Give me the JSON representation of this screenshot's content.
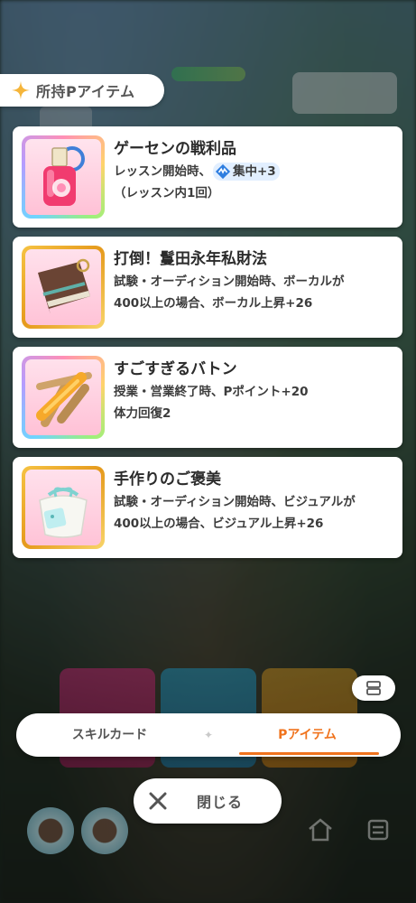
{
  "header": {
    "title": "所持Pアイテム"
  },
  "items": [
    {
      "name": "ゲーセンの戦利品",
      "desc_prefix": "レッスン開始時、",
      "chip_label": "集中+3",
      "desc_line2": "（レッスン内1回）"
    },
    {
      "name": "打倒！鬘田永年私財法",
      "desc_line1": "試験・オーディション開始時、ボーカルが",
      "desc_line2": "400以上の場合、ボーカル上昇+26"
    },
    {
      "name": "すごすぎるバトン",
      "desc_line1": "授業・営業終了時、Pポイント+20",
      "desc_line2": "体力回復2"
    },
    {
      "name": "手作りのご褒美",
      "desc_line1": "試験・オーディション開始時、ビジュアルが",
      "desc_line2": "400以上の場合、ビジュアル上昇+26"
    }
  ],
  "tabs": [
    {
      "label": "スキルカード",
      "active": false
    },
    {
      "label": "Pアイテム",
      "active": true
    }
  ],
  "close_button": {
    "label": "閉じる"
  },
  "colors": {
    "accent": "#f0731d",
    "chip_bg": "#e2efff",
    "frame_gold": "#e59a1c"
  }
}
